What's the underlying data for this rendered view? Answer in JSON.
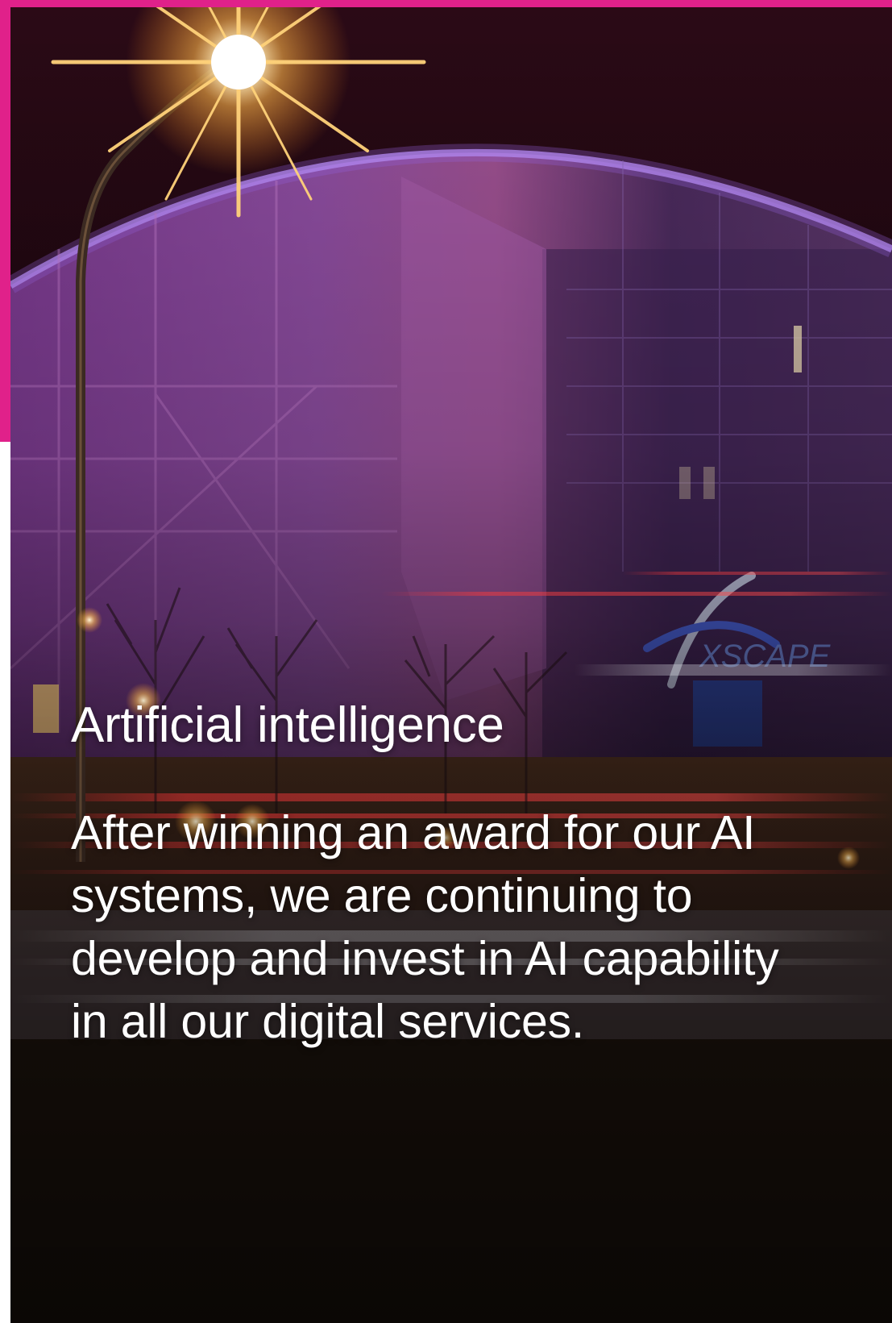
{
  "card": {
    "title": "Artificial intelligence",
    "body": "After winning an award for our AI systems, we are continuing to develop and invest in AI capability in all our digital services.",
    "image": {
      "subject": "building-at-night",
      "building_sign": "XSCAPE"
    }
  },
  "colors": {
    "accent": "#e0218a",
    "text": "#ffffff",
    "building_glow": "#a24fd0",
    "street_light": "#ffb347"
  }
}
